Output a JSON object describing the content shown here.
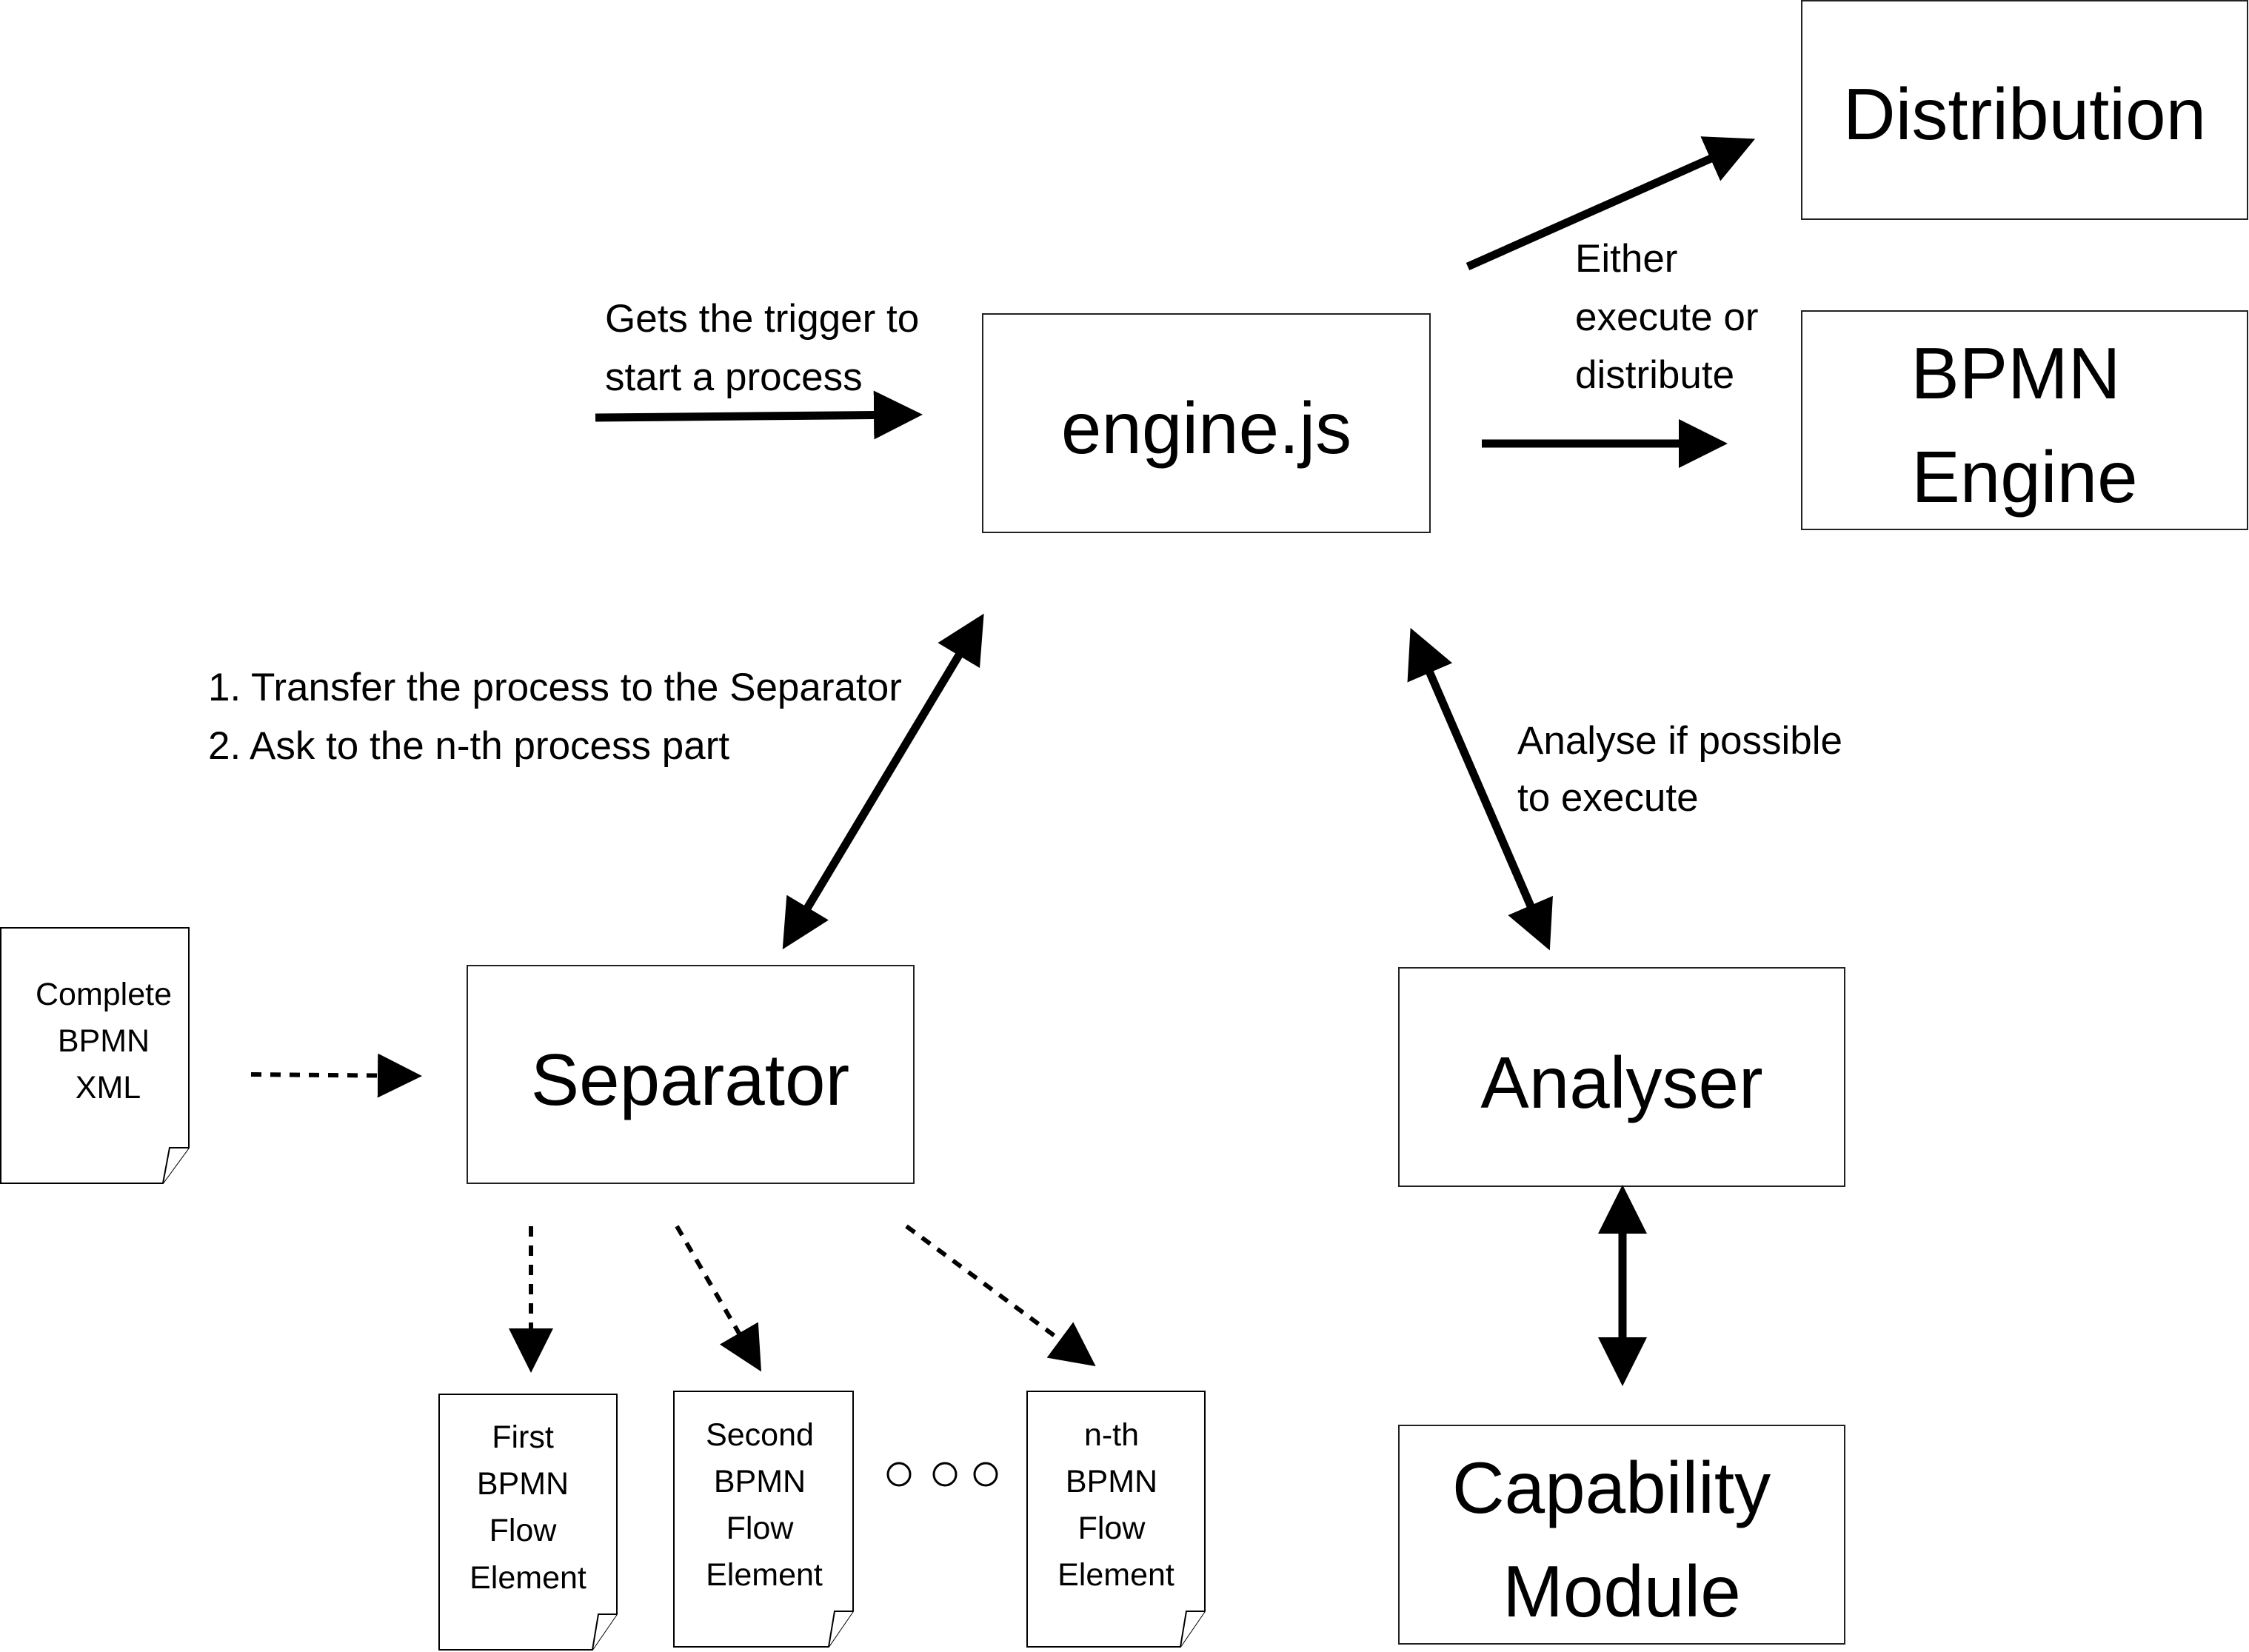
{
  "boxes": {
    "distribution": "Distribution",
    "bpmn_engine": [
      "BPMN",
      "Engine"
    ],
    "engine_js": "engine.js",
    "separator": "Separator",
    "analyser": "Analyser",
    "capability_module": [
      "Capability",
      "Module"
    ]
  },
  "documents": {
    "complete_xml": [
      "Complete",
      "BPMN",
      "XML"
    ],
    "first": [
      "First",
      "BPMN",
      "Flow",
      "Element"
    ],
    "second": [
      "Second",
      "BPMN",
      "Flow",
      "Element"
    ],
    "nth": [
      "n-th",
      "BPMN",
      "Flow",
      "Element"
    ]
  },
  "labels": {
    "trigger": [
      "Gets the trigger to",
      "start a process"
    ],
    "either": [
      "Either",
      "execute or",
      "distribute"
    ],
    "separator_steps": [
      "1. Transfer the process to the Separator",
      "2. Ask to the n-th process part"
    ],
    "analyse": [
      "Analyse if possible",
      "to execute"
    ]
  }
}
